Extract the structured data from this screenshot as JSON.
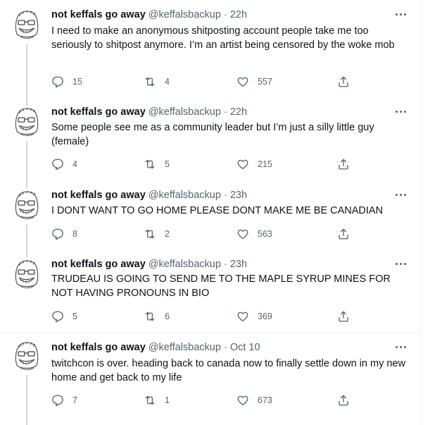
{
  "tweets": [
    {
      "name": "not keffals go away",
      "handle": "@keffalsbackup",
      "dot": "·",
      "time": "22h",
      "text": "I need to make an anonymous shitposting account people take me too seriously to shitpost anymore. I’m an artist being censored by the woke mob",
      "replies": "15",
      "retweets": "4",
      "likes": "557"
    },
    {
      "name": "not keffals go away",
      "handle": "@keffalsbackup",
      "dot": "·",
      "time": "22h",
      "text": "Some people see me as a community leader but I’m just a silly little guy (female)",
      "replies": "4",
      "retweets": "5",
      "likes": "215"
    },
    {
      "name": "not keffals go away",
      "handle": "@keffalsbackup",
      "dot": "·",
      "time": "23h",
      "text": "I DONT WANT TO GO HOME PLEASE DONT MAKE ME BE CANADIAN",
      "replies": "8",
      "retweets": "2",
      "likes": "563"
    },
    {
      "name": "not keffals go away",
      "handle": "@keffalsbackup",
      "dot": "·",
      "time": "23h",
      "text": "TRUDEAU IS GOING TO SEND ME TO THE MAPLE SYRUP MINES FOR NOT HAVING PRONOUNS IN BIO",
      "replies": "5",
      "retweets": "6",
      "likes": "369"
    },
    {
      "name": "not keffals go away",
      "handle": "@keffalsbackup",
      "dot": "·",
      "time": "Oct 10",
      "text": "twitchcon is over. heading back to canada now to finally settle down in my new home and get back to my life",
      "replies": "7",
      "retweets": "1",
      "likes": "673"
    }
  ],
  "icons": {
    "avatar": "wojak-glasses-avatar",
    "more": "more-horizontal-icon",
    "reply": "reply-icon",
    "retweet": "retweet-icon",
    "like": "heart-icon",
    "share": "share-icon"
  },
  "colors": {
    "text": "#0f1419",
    "secondary": "#536471",
    "border": "#eff3f4",
    "thread": "#cfd9de"
  }
}
